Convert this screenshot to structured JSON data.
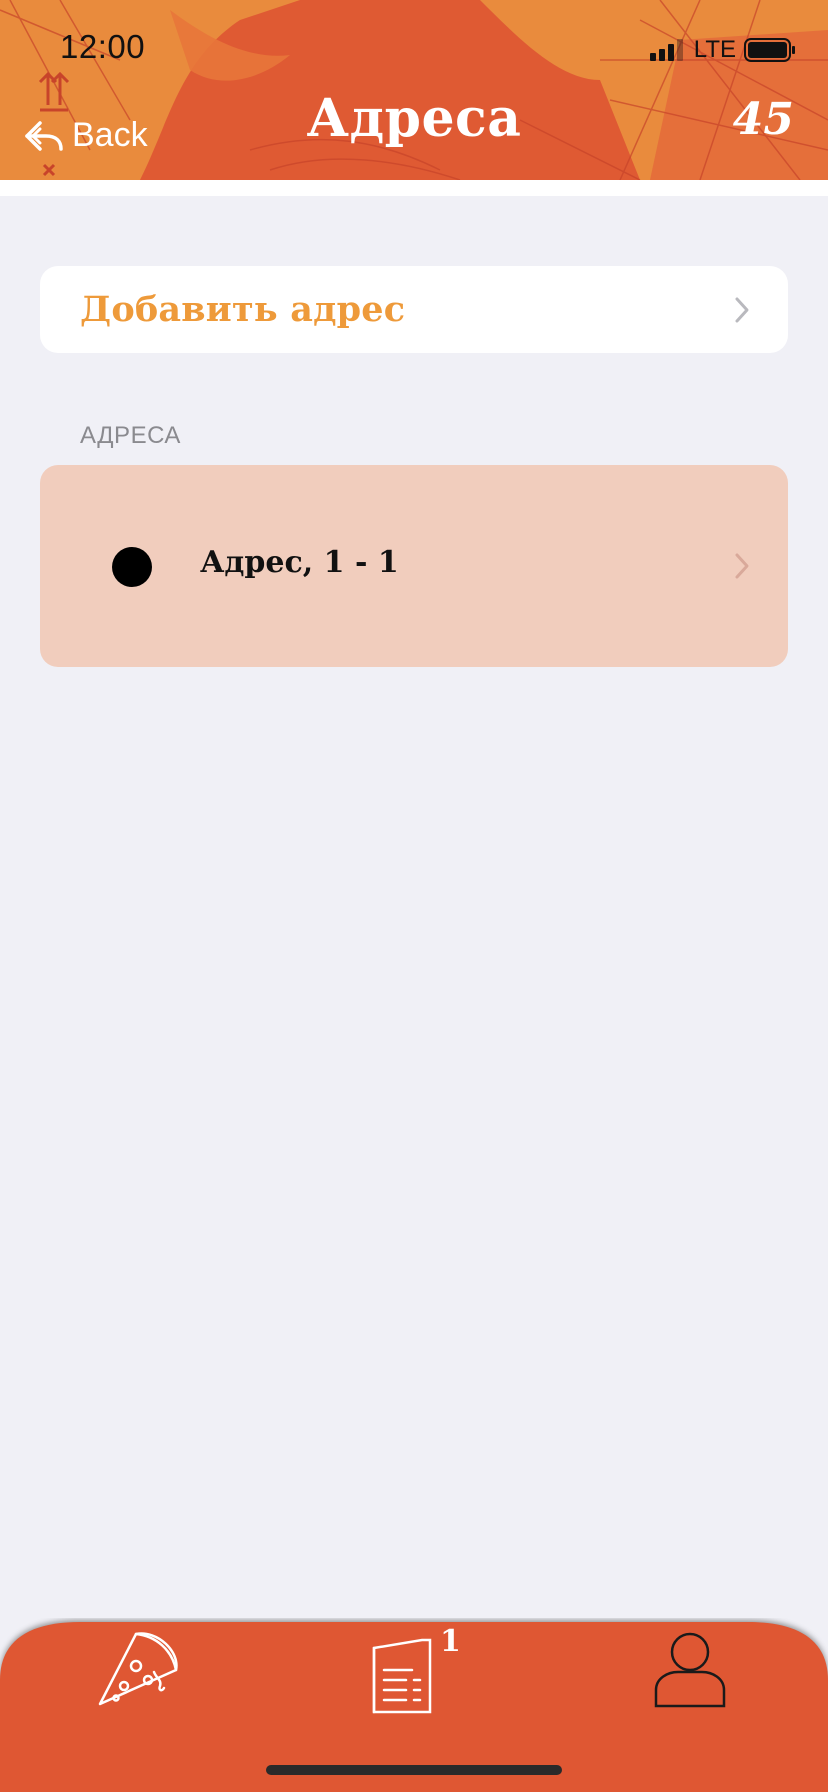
{
  "status_bar": {
    "time": "12:00",
    "network": "LTE"
  },
  "header": {
    "back_label": "Back",
    "title": "Адреса",
    "count": "45",
    "background_color": "#e8893a"
  },
  "add_address": {
    "label": "Добавить адрес",
    "color": "#ee9a3a"
  },
  "addresses_section": {
    "header": "АДРЕСА",
    "items": [
      {
        "label": "Адрес, 1 - 1",
        "selected": true,
        "background_color": "#f1cdbd"
      }
    ]
  },
  "tab_bar": {
    "background_color": "#df5733",
    "tabs": [
      {
        "icon": "pizza-icon"
      },
      {
        "icon": "orders-icon",
        "badge": "1"
      },
      {
        "icon": "profile-icon"
      }
    ]
  }
}
